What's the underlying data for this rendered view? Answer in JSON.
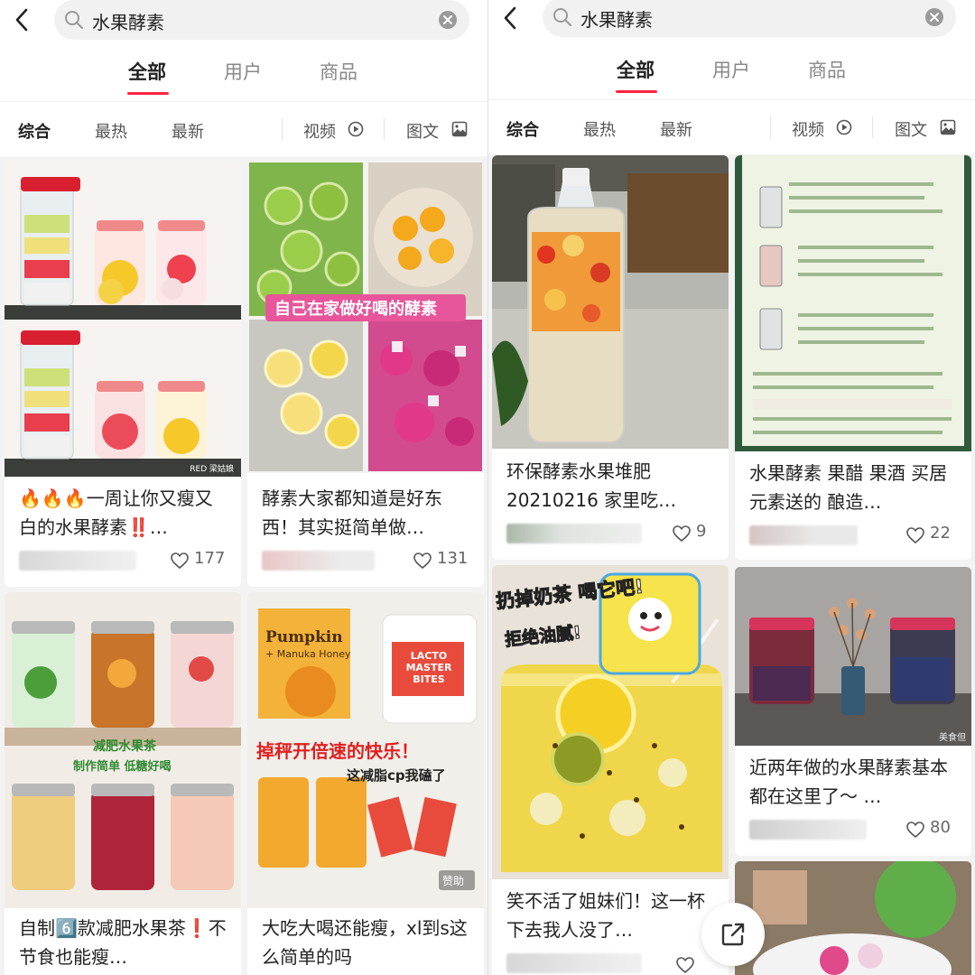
{
  "colors": {
    "accent": "#ff2442",
    "text": "#222222",
    "muted": "#888888"
  },
  "left": {
    "search": {
      "query": "水果酵素"
    },
    "main_tabs": [
      "全部",
      "用户",
      "商品"
    ],
    "sub_tabs": [
      "综合",
      "最热",
      "最新"
    ],
    "filter_video": "视频",
    "filter_image": "图文",
    "cards": [
      {
        "title": "🔥🔥🔥一周让你又瘦又白的水果酵素‼️…",
        "likes": "177",
        "watermark": "RED 梁姑娘"
      },
      {
        "title": "酵素大家都知道是好东西！其实挺简单做…",
        "likes": "131",
        "overlay": "自己在家做好喝的酵素"
      },
      {
        "title": "自制6️⃣款减肥水果茶❗不节食也能瘦…",
        "overlay_1": "减肥水果茶",
        "overlay_2": "制作简单 低糖好喝"
      },
      {
        "title": "大吃大喝还能瘦，xl到s这么简单的吗",
        "overlay_1": "掉秤开倍速的快乐！",
        "overlay_2": "这减脂cp我磕了",
        "sponsored": "赞助",
        "pkg_1": "Pumpkin",
        "pkg_2": "+ Manuka Honey",
        "pkg_3": "LACTO MASTER BITES"
      }
    ]
  },
  "right": {
    "search": {
      "query": "水果酵素"
    },
    "main_tabs": [
      "全部",
      "用户",
      "商品"
    ],
    "sub_tabs": [
      "综合",
      "最热",
      "最新"
    ],
    "filter_video": "视频",
    "filter_image": "图文",
    "cards": [
      {
        "title": "环保酵素水果堆肥20210216 家里吃…",
        "likes": "9"
      },
      {
        "title": "水果酵素 果醋 果酒 买居元素送的 酿造…",
        "likes": "22"
      },
      {
        "title": "笑不活了姐妹们！这一杯下去我人没了…",
        "overlay_1": "扔掉奶茶 喝它吧!",
        "overlay_2": "拒绝油腻!"
      },
      {
        "title": "近两年做的水果酵素基本都在这里了～ …",
        "likes": "80",
        "watermark": "美食但"
      }
    ]
  }
}
